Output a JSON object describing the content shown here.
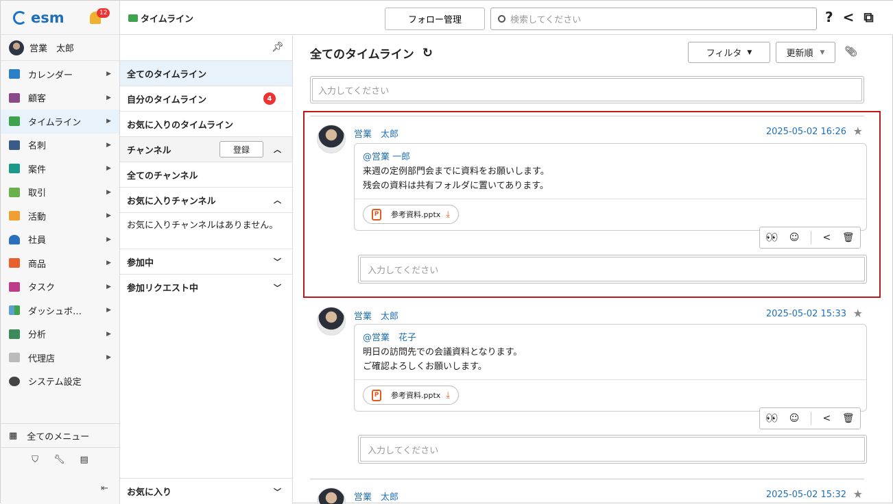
{
  "app": {
    "logo": "esm",
    "notifications": "12"
  },
  "user": {
    "name": "営業　太郎"
  },
  "nav": {
    "items": [
      {
        "label": "カレンダー",
        "icon": "calendar-icon",
        "color": "#2a7fc9"
      },
      {
        "label": "顧客",
        "icon": "building-icon",
        "color": "#8a4a8a"
      },
      {
        "label": "タイムライン",
        "icon": "chat-icon",
        "color": "#3fa34d"
      },
      {
        "label": "名刺",
        "icon": "business-card-icon",
        "color": "#3a5a8a"
      },
      {
        "label": "案件",
        "icon": "folder-icon",
        "color": "#1a9a8a"
      },
      {
        "label": "取引",
        "icon": "deal-icon",
        "color": "#6ab04c"
      },
      {
        "label": "活動",
        "icon": "clipboard-icon",
        "color": "#f0a030"
      },
      {
        "label": "社員",
        "icon": "person-icon",
        "color": "#2a6fc0"
      },
      {
        "label": "商品",
        "icon": "box-icon",
        "color": "#e8602c"
      },
      {
        "label": "タスク",
        "icon": "checkbox-icon",
        "color": "#c03a8a"
      },
      {
        "label": "ダッシュボ…",
        "icon": "dashboard-icon",
        "color": "#5aa0d0"
      },
      {
        "label": "分析",
        "icon": "chart-icon",
        "color": "#3a8a5a"
      },
      {
        "label": "代理店",
        "icon": "document-icon",
        "color": "#bbbbbb"
      },
      {
        "label": "システム設定",
        "icon": "gear-icon",
        "color": "#444444"
      }
    ],
    "all_menu": "全てのメニュー",
    "tools": [
      "shield-icon",
      "wrench-icon",
      "table-icon"
    ]
  },
  "topbar": {
    "title": "タイムライン",
    "follow_btn": "フォロー管理",
    "search_placeholder": "検索してください",
    "help": "?"
  },
  "middle": {
    "items": [
      {
        "label": "全てのタイムライン"
      },
      {
        "label": "自分のタイムライン",
        "badge": "4"
      },
      {
        "label": "お気に入りのタイムライン"
      }
    ],
    "channel_header": "チャンネル",
    "register_btn": "登録",
    "all_channels": "全てのチャンネル",
    "fav_channels": "お気に入りチャンネル",
    "no_fav": "お気に入りチャンネルはありません。",
    "joined": "参加中",
    "join_requests": "参加リクエスト中",
    "favorites": "お気に入り"
  },
  "main": {
    "title": "全てのタイムライン",
    "filter_btn": "フィルタ",
    "sort_btn": "更新順",
    "input_placeholder": "入力してください"
  },
  "posts": [
    {
      "author": "営業　太郎",
      "timestamp": "2025-05-02 16:26",
      "mention": "@営業 一郎",
      "lines": [
        "来週の定例部門会までに資料をお願いします。",
        "残会の資料は共有フォルダに置いてあります。"
      ],
      "attachment": "参考資料.pptx",
      "reply_placeholder": "入力してください"
    },
    {
      "author": "営業　太郎",
      "timestamp": "2025-05-02 15:33",
      "mention": "@営業　花子",
      "lines": [
        "明日の訪問先での会議資料となります。",
        "ご確認よろしくお願いします。"
      ],
      "attachment": "参考資料.pptx",
      "reply_placeholder": "入力してください"
    },
    {
      "author": "営業　太郎",
      "timestamp": "2025-05-02 15:32"
    }
  ],
  "colors": {
    "accent": "#1f6fb8",
    "highlight": "#c0171b",
    "badge": "#e33333",
    "attachment": "#e35a1c"
  }
}
